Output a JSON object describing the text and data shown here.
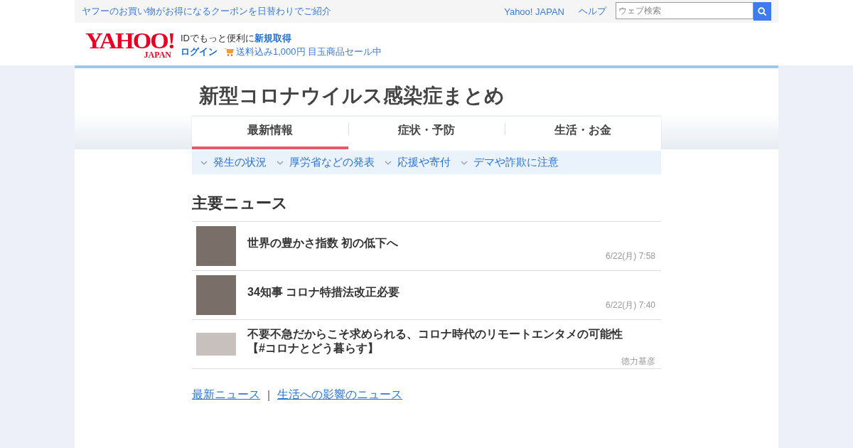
{
  "promo_bar": {
    "link": "ヤフーのお買い物がお得になるクーポンを日替わりでご紹介",
    "nav_links": [
      "Yahoo! JAPAN",
      "ヘルプ"
    ],
    "search": {
      "placeholder": "ウェブ検索"
    }
  },
  "header": {
    "logo": {
      "main": "YAHOO!",
      "sub": "JAPAN"
    },
    "id_text": "IDでもっと便利に",
    "signup_link": "新規取得",
    "login_link": "ログイン",
    "sale_link": "送料込み1,000円 目玉商品セール中"
  },
  "page_title": "新型コロナウイルス感染症まとめ",
  "tabs": [
    {
      "label": "最新情報",
      "selected": true
    },
    {
      "label": "症状・予防",
      "selected": false
    },
    {
      "label": "生活・お金",
      "selected": false
    }
  ],
  "anchor_links": [
    "発生の状況",
    "厚労省などの発表",
    "応援や寄付",
    "デマや詐欺に注意"
  ],
  "section_title": "主要ニュース",
  "news": [
    {
      "title": "世界の豊かさ指数 初の低下へ",
      "byline": "6/22(月) 7:58",
      "kind": "square"
    },
    {
      "title": "34知事 コロナ特措法改正必要",
      "byline": "6/22(月) 7:40",
      "kind": "square"
    },
    {
      "title": "不要不急だからこそ求められる、コロナ時代のリモートエンタメの可能性【#コロナとどう暮らす】",
      "byline": "徳力基彦",
      "kind": "wide"
    }
  ],
  "footer_links": [
    "最新ニュース",
    "生活への影響のニュース"
  ],
  "footer_separator": "|"
}
